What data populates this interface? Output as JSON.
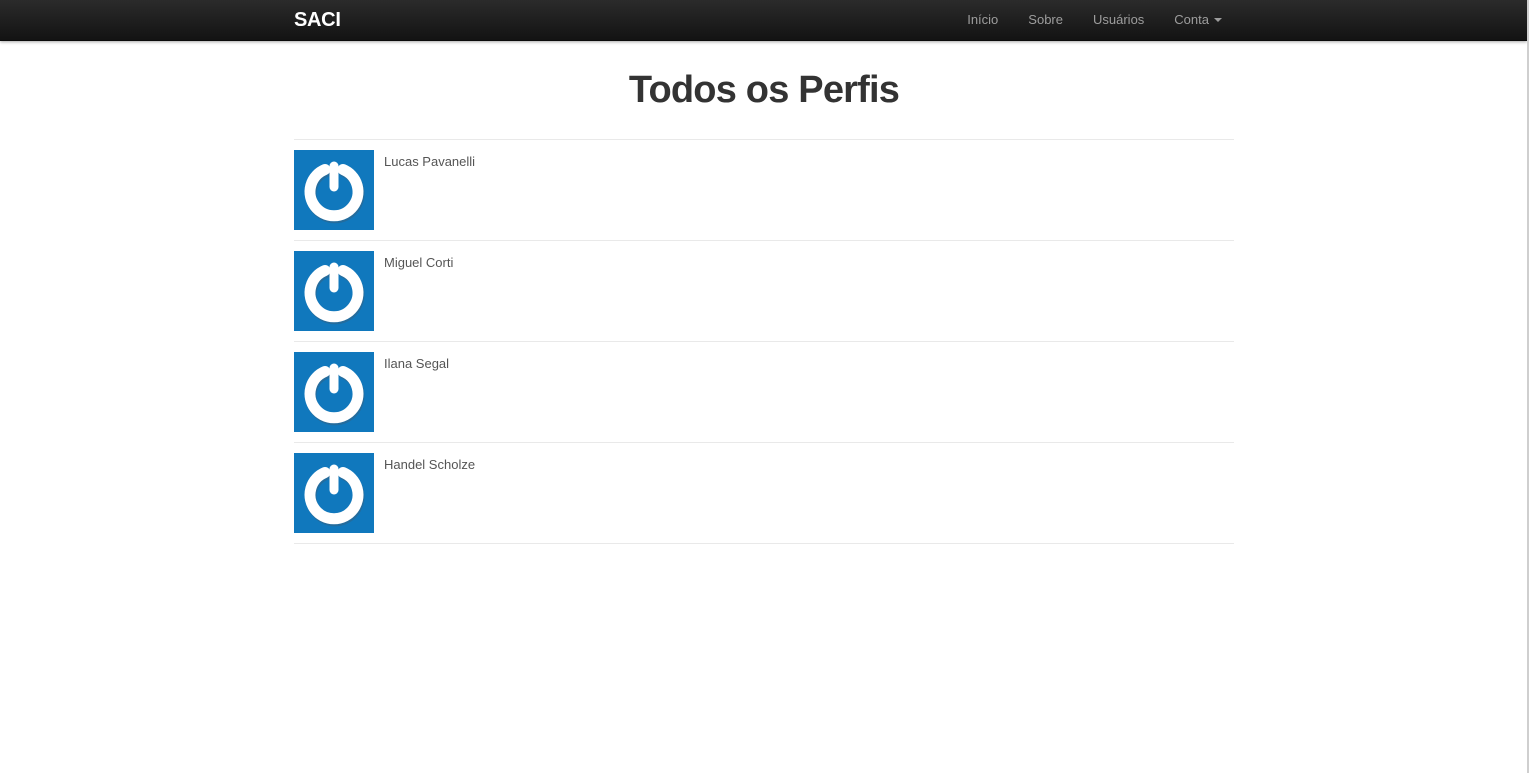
{
  "navbar": {
    "brand": "SACI",
    "items": [
      {
        "label": "Início"
      },
      {
        "label": "Sobre"
      },
      {
        "label": "Usuários"
      },
      {
        "label": "Conta"
      }
    ]
  },
  "main": {
    "title": "Todos os Perfis",
    "profiles": [
      {
        "name": "Lucas Pavanelli",
        "avatar_icon": "gravatar-icon"
      },
      {
        "name": "Miguel Corti",
        "avatar_icon": "gravatar-icon"
      },
      {
        "name": "Ilana Segal",
        "avatar_icon": "gravatar-icon"
      },
      {
        "name": "Handel Scholze",
        "avatar_icon": "gravatar-icon"
      }
    ]
  },
  "colors": {
    "navbar_bg": "#1b1b1b",
    "nav_text": "#9d9d9d",
    "brand_text": "#ffffff",
    "avatar_bg": "#1078bd",
    "divider": "#e9e9e9"
  }
}
